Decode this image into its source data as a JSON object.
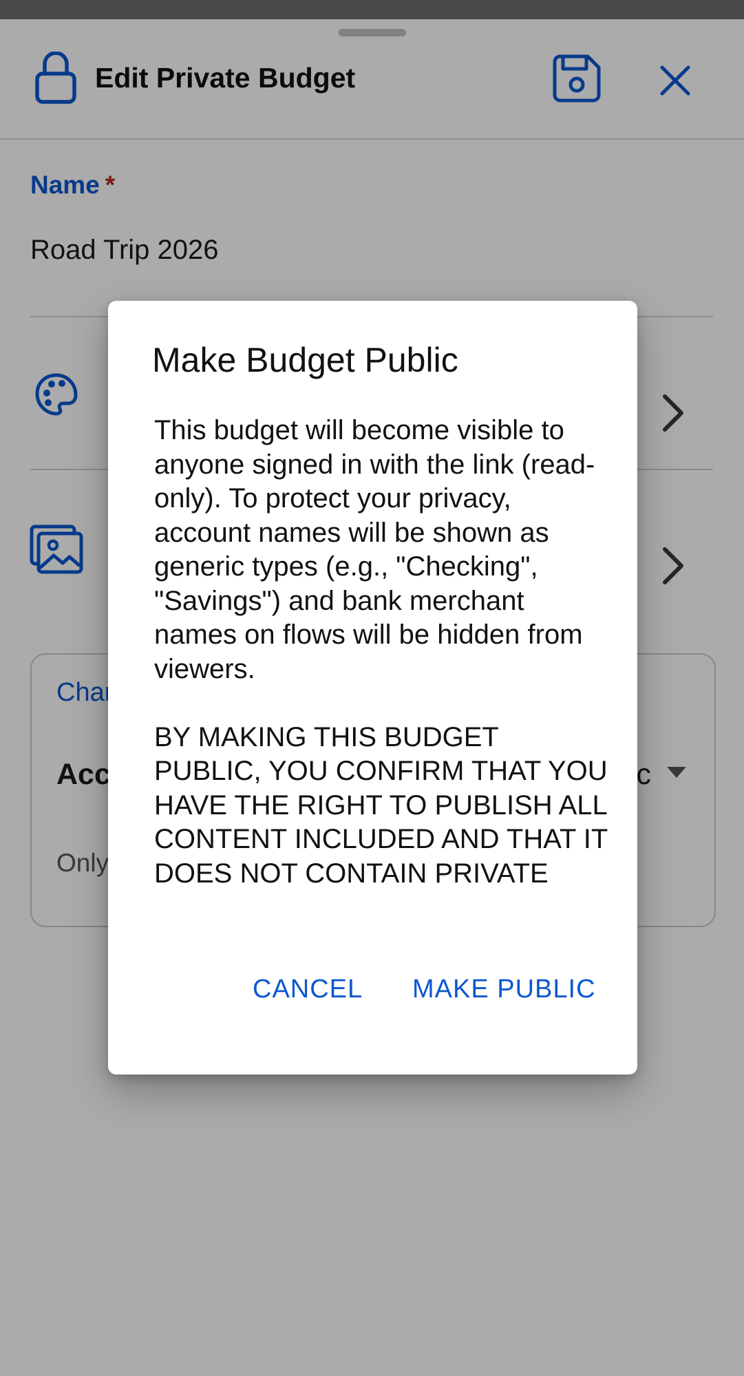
{
  "header": {
    "title": "Edit Private Budget",
    "lock_icon": "lock-icon",
    "save_icon": "save-icon",
    "close_icon": "close-icon"
  },
  "form": {
    "name_label": "Name",
    "required_mark": "*",
    "name_value": "Road Trip 2026",
    "color_row_icon": "palette-icon",
    "image_row_icon": "image-icon",
    "chevron_icon": "chevron-right-icon"
  },
  "access_card": {
    "label_partial": "Char",
    "title_partial": "Acc",
    "value_partial": "ic",
    "help_partial": "Only",
    "dropdown_icon": "caret-down-icon"
  },
  "dialog": {
    "title": "Make Budget Public",
    "paragraph_1": "This budget will become visible to anyone signed in with the link (read-only). To protect your privacy, account names will be shown as generic types (e.g., \"Checking\", \"Savings\") and bank merchant names on flows will be hidden from viewers.",
    "paragraph_2": "BY MAKING THIS BUDGET PUBLIC, YOU CONFIRM THAT YOU HAVE THE RIGHT TO PUBLISH ALL CONTENT INCLUDED AND THAT IT DOES NOT CONTAIN PRIVATE",
    "cancel_label": "CANCEL",
    "confirm_label": "MAKE PUBLIC"
  },
  "colors": {
    "accent": "#0b57d0",
    "required": "#b3261e",
    "scrim": "rgba(0,0,0,0.33)"
  }
}
